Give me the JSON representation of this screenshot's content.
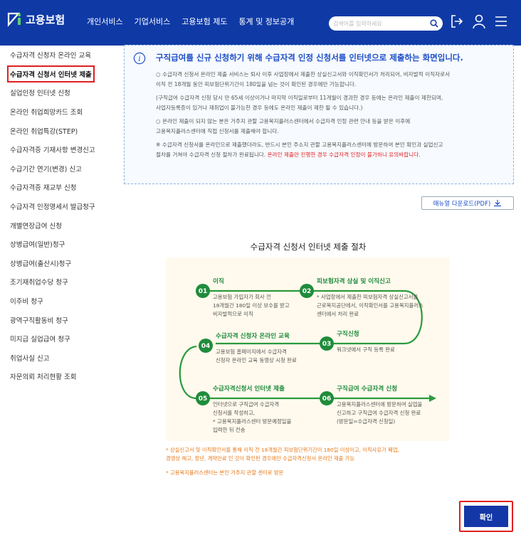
{
  "header": {
    "logo_text": "고용보험",
    "nav": [
      "개인서비스",
      "기업서비스",
      "고용보험 제도",
      "통계 및 정보공개"
    ],
    "search_placeholder": "검색어를 입력하세요",
    "accent_color": "#0f3aa6"
  },
  "sidebar": {
    "items": [
      {
        "label": "수급자격 신청자 온라인 교육"
      },
      {
        "label": "수급자격 신청서 인터넷 제출",
        "active": true
      },
      {
        "label": "실업인정 인터넷 신청"
      },
      {
        "label": "온라인 취업희망카드 조회"
      },
      {
        "label": "온라인 취업특강(STEP)"
      },
      {
        "label": "수급자격증 기재사항 변경신고"
      },
      {
        "label": "수급기간 연기(변경) 신고"
      },
      {
        "label": "수급자격증 재교부 신청"
      },
      {
        "label": "수급자격 인정명세서 발급청구"
      },
      {
        "label": "개별연장급여 신청"
      },
      {
        "label": "상병급여(일반)청구"
      },
      {
        "label": "상병급여(출산시)청구"
      },
      {
        "label": "조기재취업수당 청구"
      },
      {
        "label": "이주비 청구"
      },
      {
        "label": "광역구직활동비 청구"
      },
      {
        "label": "미지급 실업급여 청구"
      },
      {
        "label": "취업사실 신고"
      },
      {
        "label": "자문의뢰 처리현황 조회"
      }
    ]
  },
  "info": {
    "title": "구직급여를 신규 신청하기 위해 수급자격 인정 신청서를 인터넷으로 제출하는 화면입니다.",
    "p1": "○ 수급자격 신청서 온라인 제출 서비스는 퇴사 이후 사업장에서 제출한 상실신고서와 이직확인서가 처리되어, 비자발적 이직자로서\n이직 전 18개월 동안 피보험단위기간이 180일을 넘는 것이 확인된 경우에만 가능합니다.",
    "p2": "(구직급여 수급자격 신청 당시 만 65세 이상이거나 마지막 이직일로부터 11개월이 경과한 경우 등에는 온라인 제출이 제한되며,\n사업자등록증이 있거나 재취업이 불가능한 경우 등에도 온라인 제출이 제한 될 수 있습니다.)",
    "p3": "○ 온라인 제출이 되지 않는 분은 거주지 관할 고용복지플러스센터에서 수급자격 인정 관련 안내 등을 받은 이후에\n고용복지플러스센터에 직접 신청서를 제출해야 합니다.",
    "p4": "※ 수급자격 신청서를 온라인으로 제출했더라도, 반드시 본인 주소지 관할 고용복지플러스센터에 방문하여 본인 확인과 실업신고\n절차를 거쳐야 수급자격 신청 절차가 완료됩니다. ",
    "p4_red": "온라인 제출만 진행한 경우 수급자격 인정이 불가하니 유의바랍니다."
  },
  "manual_label": "매뉴얼 다운로드(PDF)",
  "procedure": {
    "title": "수급자격 신청서 인터넷 제출 절차",
    "steps": [
      {
        "num": "01",
        "title": "이직",
        "desc": [
          "고용보험 가입자가 회사 전",
          "18개월간 180일 이상 보수를 받고",
          "비자발적으로 이직"
        ]
      },
      {
        "num": "02",
        "title": "피보험자격 상실 및 이직신고",
        "desc": [
          "* 사업장에서 제출한 피보험자격 상실신고서를",
          "근로복지공단에서, 이직확인서를 고용복지플러스",
          "센터에서 처리 완료"
        ]
      },
      {
        "num": "03",
        "title": "구직신청",
        "desc": [
          "워크넷에서 구직 등록 완료"
        ]
      },
      {
        "num": "04",
        "title": "수급자격 신청자 온라인 교육",
        "desc": [
          "고용보험 홈페이지에서 수급자격",
          "신청자 온라인 교육 동영상 시청 완료"
        ]
      },
      {
        "num": "05",
        "title": "수급자격신청서 인터넷 제출",
        "desc": [
          "인터넷으로 구직급여 수급자격",
          "신청서를 작성하고,",
          "* 고용복지플러스센터 방문예정일을",
          "입력한 뒤 전송"
        ]
      },
      {
        "num": "06",
        "title": "구직급여 수급자격 신청",
        "desc": [
          "고용복지플러스센터에 방문하여 실업을",
          "신고하고 구직급여 수급자격 신청 완료",
          "(방문일=수급자격 신청일)"
        ]
      }
    ]
  },
  "notes": {
    "n1": "* 상실신고서 및 이직확인서를 통해 이직 전 18개월간 피보험단위기간이 180일 이상이고, 이직사유가 폐업,\n경영상 해고, 정년, 계약만료 인 것이 확인된 경우에만 수급자격신청서 온라인 제출 가능",
    "n2": "* 고용복지플러스센터는 본인 거주지 관할 센터로 방문"
  },
  "confirm_label": "확인"
}
